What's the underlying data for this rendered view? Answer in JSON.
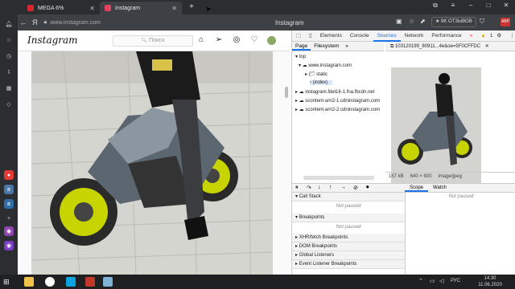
{
  "tabs": [
    {
      "label": "MEGA 6%",
      "favicon_color": "#d9272e"
    },
    {
      "label": "Instagram",
      "favicon_color": "#e4405f"
    }
  ],
  "address_bar": {
    "browser_letter": "Я",
    "url": "www.instagram.com",
    "page_title": "Instagram",
    "reviews_label": "★ 9K  ОТЗЫВОВ",
    "abp_label": "ABP"
  },
  "instagram": {
    "logo": "Instagram",
    "search_placeholder": "Поиск"
  },
  "devtools": {
    "tabs": [
      "Elements",
      "Console",
      "Sources",
      "Network",
      "Performance"
    ],
    "active_tab": "Sources",
    "warning_count": "1",
    "sub_tabs": [
      "Page",
      "Filesystem"
    ],
    "tree": {
      "top": "top",
      "origin": "www.instagram.com",
      "static": "static",
      "index": "(index)",
      "cdn1": "instagram.fdel16-1.fna.fbcdn.net",
      "cdn2": "scontent-arn2-1.cdninstagram.com",
      "cdn3": "scontent-arn2-2.cdninstagram.com"
    },
    "preview_file": "103120199_80911...4e&oe=5F0CFFDC",
    "file_size": "157 kB",
    "dimensions": "640 × 800",
    "mime": "image/jpeg",
    "scope_tabs": [
      "Scope",
      "Watch"
    ],
    "call_stack": "Call Stack",
    "not_paused": "Not paused",
    "breakpoints": "Breakpoints",
    "xhr": "XHR/fetch Breakpoints",
    "dom": "DOM Breakpoints",
    "global": "Global Listeners",
    "event": "Event Listener Breakpoints"
  },
  "taskbar": {
    "language": "РУС",
    "time": "14:30",
    "date": "11.06.2020"
  }
}
